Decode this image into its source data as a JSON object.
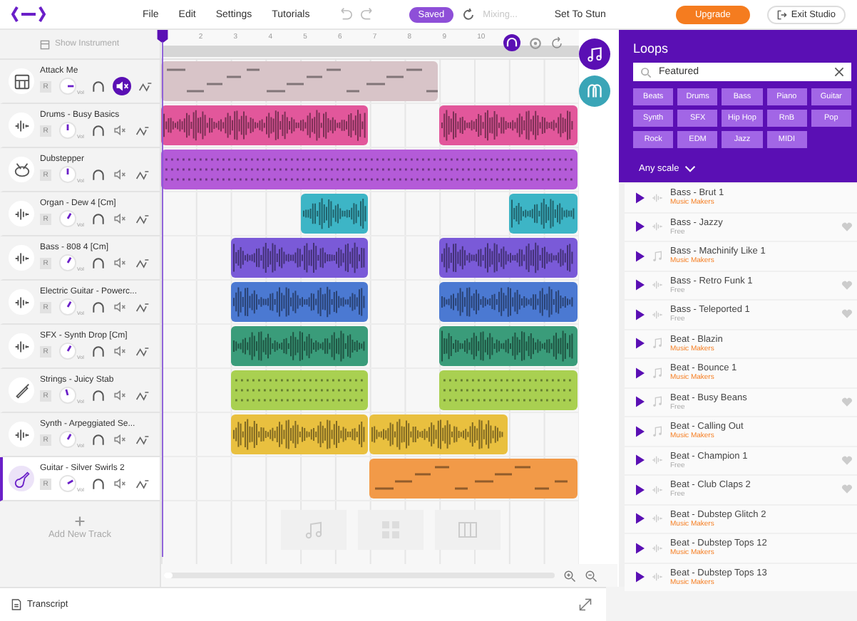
{
  "menu": [
    "File",
    "Edit",
    "Settings",
    "Tutorials"
  ],
  "save_status": "Saved",
  "sync_status": {
    "label": "Mixing...",
    "disabled": true
  },
  "project_title": "Set To Stun",
  "upgrade": "Upgrade",
  "exit": "Exit Studio",
  "show_instrument": "Show Instrument",
  "ruler": [
    "2",
    "3",
    "4",
    "5",
    "6",
    "7",
    "8",
    "9",
    "10"
  ],
  "tracks": [
    {
      "name": "Attack Me",
      "kind": "beatmaker",
      "record": "R",
      "knob_label": "Vol",
      "muted": true,
      "selected": false,
      "color": "#d8c4c8",
      "clips": [
        {
          "kind": "midi"
        }
      ]
    },
    {
      "name": "Drums - Busy Basics",
      "kind": "audio",
      "record": "R",
      "knob_label": "Vol",
      "muted": false,
      "selected": false,
      "color": "#e2579b",
      "clips": [
        {
          "kind": "waveform"
        },
        {
          "kind": "waveform"
        }
      ]
    },
    {
      "name": "Dubstepper",
      "kind": "drums",
      "record": "R",
      "knob_label": "Vol",
      "muted": false,
      "selected": false,
      "color": "#b45bd8",
      "clips": [
        {
          "kind": "pattern"
        }
      ]
    },
    {
      "name": "Organ - Dew 4 [Cm]",
      "kind": "audio",
      "record": "R",
      "knob_label": "Vol",
      "muted": false,
      "selected": false,
      "color": "#3db5c6",
      "clips": [
        {
          "kind": "waveform"
        },
        {
          "kind": "waveform"
        }
      ]
    },
    {
      "name": "Bass - 808 4 [Cm]",
      "kind": "audio",
      "record": "R",
      "knob_label": "Vol",
      "muted": false,
      "selected": false,
      "color": "#7a5ad8",
      "clips": [
        {
          "kind": "waveform"
        },
        {
          "kind": "waveform"
        }
      ]
    },
    {
      "name": "Electric Guitar - Powerc...",
      "kind": "audio",
      "record": "R",
      "knob_label": "Vol",
      "muted": false,
      "selected": false,
      "color": "#4b79d2",
      "clips": [
        {
          "kind": "waveform"
        },
        {
          "kind": "waveform"
        }
      ]
    },
    {
      "name": "SFX - Synth Drop [Cm]",
      "kind": "audio",
      "record": "R",
      "knob_label": "Vol",
      "muted": false,
      "selected": false,
      "color": "#3a9c7a",
      "clips": [
        {
          "kind": "waveform"
        },
        {
          "kind": "waveform"
        }
      ]
    },
    {
      "name": "Strings - Juicy Stab",
      "kind": "instrument",
      "record": "R",
      "knob_label": "Vol",
      "muted": false,
      "selected": false,
      "color": "#a9d051",
      "clips": [
        {
          "kind": "pattern"
        },
        {
          "kind": "pattern"
        }
      ]
    },
    {
      "name": "Synth - Arpeggiated Se...",
      "kind": "audio",
      "record": "R",
      "knob_label": "Vol",
      "muted": false,
      "selected": false,
      "color": "#e9c03f",
      "clips": [
        {
          "kind": "waveform"
        },
        {
          "kind": "waveform"
        }
      ]
    },
    {
      "name": "Guitar - Silver Swirls 2",
      "kind": "guitar",
      "record": "R",
      "knob_label": "Vol",
      "muted": false,
      "selected": true,
      "color": "#f29a48",
      "clips": [
        {
          "kind": "midi"
        }
      ]
    }
  ],
  "add_track": "Add New Track",
  "transcript": "Transcript",
  "loops": {
    "title": "Loops",
    "search": {
      "value": "Featured"
    },
    "tags": [
      "Beats",
      "Drums",
      "Bass",
      "Piano",
      "Guitar",
      "Synth",
      "SFX",
      "Hip Hop",
      "RnB",
      "Pop",
      "Rock",
      "EDM",
      "Jazz",
      "MIDI"
    ],
    "scale": "Any scale",
    "items": [
      {
        "name": "Bass - Brut 1",
        "source": "Music Makers",
        "premium": true,
        "kind": "audio",
        "favorite": false
      },
      {
        "name": "Bass - Jazzy",
        "source": "Free",
        "premium": false,
        "kind": "audio",
        "favorite": true
      },
      {
        "name": "Bass - Machinify Like 1",
        "source": "Music Makers",
        "premium": true,
        "kind": "midi",
        "favorite": false
      },
      {
        "name": "Bass - Retro Funk 1",
        "source": "Free",
        "premium": false,
        "kind": "audio",
        "favorite": true
      },
      {
        "name": "Bass - Teleported 1",
        "source": "Free",
        "premium": false,
        "kind": "audio",
        "favorite": true
      },
      {
        "name": "Beat - Blazin",
        "source": "Music Makers",
        "premium": true,
        "kind": "midi",
        "favorite": false
      },
      {
        "name": "Beat - Bounce 1",
        "source": "Music Makers",
        "premium": true,
        "kind": "midi",
        "favorite": false
      },
      {
        "name": "Beat - Busy Beans",
        "source": "Free",
        "premium": false,
        "kind": "midi",
        "favorite": true
      },
      {
        "name": "Beat - Calling Out",
        "source": "Music Makers",
        "premium": true,
        "kind": "midi",
        "favorite": false
      },
      {
        "name": "Beat - Champion 1",
        "source": "Free",
        "premium": false,
        "kind": "audio",
        "favorite": true
      },
      {
        "name": "Beat - Club Claps 2",
        "source": "Free",
        "premium": false,
        "kind": "audio",
        "favorite": true
      },
      {
        "name": "Beat - Dubstep Glitch 2",
        "source": "Music Makers",
        "premium": true,
        "kind": "audio",
        "favorite": false
      },
      {
        "name": "Beat - Dubstep Tops 12",
        "source": "Music Makers",
        "premium": true,
        "kind": "audio",
        "favorite": false
      },
      {
        "name": "Beat - Dubstep Tops 13",
        "source": "Music Makers",
        "premium": true,
        "kind": "audio",
        "favorite": false
      }
    ]
  }
}
